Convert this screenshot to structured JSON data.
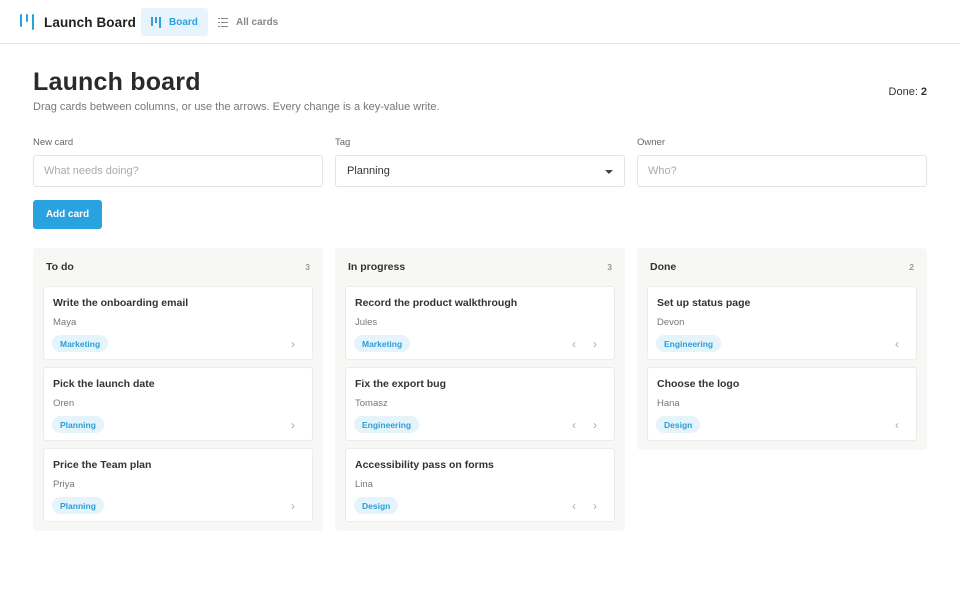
{
  "app": {
    "title": "Launch Board",
    "nav": [
      {
        "label": "Board",
        "active": true
      },
      {
        "label": "All cards",
        "active": false
      }
    ]
  },
  "header": {
    "title": "Launch board",
    "subtitle": "Drag cards between columns, or use the arrows. Every change is a key-value write.",
    "done_label": "Done:",
    "done_value": "2"
  },
  "form": {
    "new_card_label": "New card",
    "new_card_placeholder": "What needs doing?",
    "tag_label": "Tag",
    "tag_value": "Planning",
    "owner_label": "Owner",
    "owner_placeholder": "Who?",
    "add_button": "Add card"
  },
  "columns": [
    {
      "title": "To do",
      "count": "3",
      "cards": [
        {
          "title": "Write the onboarding email",
          "owner": "Maya",
          "tag": "Marketing"
        },
        {
          "title": "Pick the launch date",
          "owner": "Oren",
          "tag": "Planning"
        },
        {
          "title": "Price the Team plan",
          "owner": "Priya",
          "tag": "Planning"
        }
      ]
    },
    {
      "title": "In progress",
      "count": "3",
      "cards": [
        {
          "title": "Record the product walkthrough",
          "owner": "Jules",
          "tag": "Marketing"
        },
        {
          "title": "Fix the export bug",
          "owner": "Tomasz",
          "tag": "Engineering"
        },
        {
          "title": "Accessibility pass on forms",
          "owner": "Lina",
          "tag": "Design"
        }
      ]
    },
    {
      "title": "Done",
      "count": "2",
      "cards": [
        {
          "title": "Set up status page",
          "owner": "Devon",
          "tag": "Engineering"
        },
        {
          "title": "Choose the logo",
          "owner": "Hana",
          "tag": "Design"
        }
      ]
    }
  ],
  "icons": {
    "arrow_left": "chevron-left-icon",
    "arrow_right": "chevron-right-icon",
    "accent_color": "#29a3e0"
  }
}
